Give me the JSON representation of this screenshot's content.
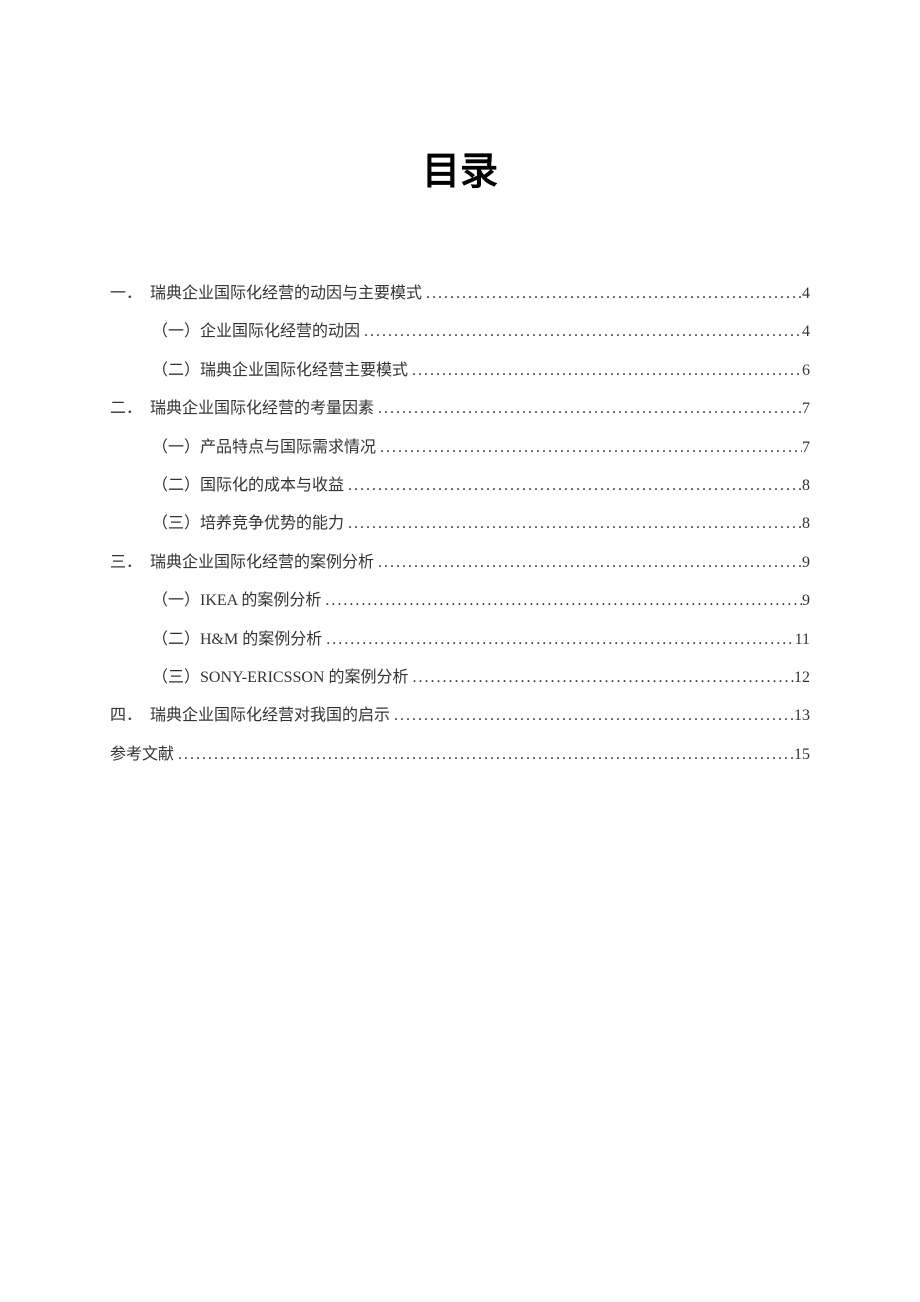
{
  "title": "目录",
  "toc": [
    {
      "level": 1,
      "prefix": "一．",
      "label": "瑞典企业国际化经营的动因与主要模式",
      "page": "4"
    },
    {
      "level": 2,
      "prefix": "",
      "label": "（一）企业国际化经营的动因",
      "page": "4"
    },
    {
      "level": 2,
      "prefix": "",
      "label": "（二）瑞典企业国际化经营主要模式",
      "page": "6"
    },
    {
      "level": 1,
      "prefix": "二．",
      "label": "瑞典企业国际化经营的考量因素",
      "page": "7"
    },
    {
      "level": 2,
      "prefix": "",
      "label": "（一）产品特点与国际需求情况",
      "page": "7"
    },
    {
      "level": 2,
      "prefix": "",
      "label": "（二）国际化的成本与收益",
      "page": "8"
    },
    {
      "level": 2,
      "prefix": "",
      "label": "（三）培养竞争优势的能力",
      "page": "8"
    },
    {
      "level": 1,
      "prefix": "三．",
      "label": "瑞典企业国际化经营的案例分析",
      "page": "9"
    },
    {
      "level": 2,
      "prefix": "",
      "label": "（一）IKEA 的案例分析 ",
      "page": "9"
    },
    {
      "level": 2,
      "prefix": "",
      "label": "（二）H&M 的案例分析 ",
      "page": "11"
    },
    {
      "level": 2,
      "prefix": "",
      "label": "（三）SONY-ERICSSON 的案例分析 ",
      "page": "12"
    },
    {
      "level": 1,
      "prefix": "四．",
      "label": "瑞典企业国际化经营对我国的启示",
      "page": "13"
    },
    {
      "level": 0,
      "prefix": "",
      "label": "参考文献",
      "page": "15"
    }
  ]
}
